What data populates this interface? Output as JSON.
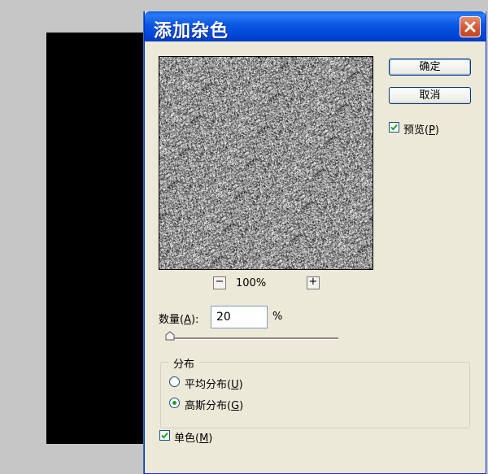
{
  "dialog": {
    "title": "添加杂色",
    "ok_label": "确定",
    "cancel_label": "取消"
  },
  "preview": {
    "checkbox_label": "预览(",
    "checkbox_key": "P",
    "checkbox_close": ")",
    "checked": true,
    "zoom_minus": "−",
    "zoom_plus": "+",
    "zoom_level": "100%"
  },
  "amount": {
    "label_pre": "数量(",
    "label_key": "A",
    "label_post": "):",
    "value": "20",
    "unit": "%"
  },
  "distribution": {
    "title": "分布",
    "options": [
      {
        "label": "平均分布(",
        "key": "U",
        "close": ")",
        "selected": false
      },
      {
        "label": "高斯分布(",
        "key": "G",
        "close": ")",
        "selected": true
      }
    ]
  },
  "monochrome": {
    "label": "单色(",
    "key": "M",
    "close": ")",
    "checked": true
  }
}
